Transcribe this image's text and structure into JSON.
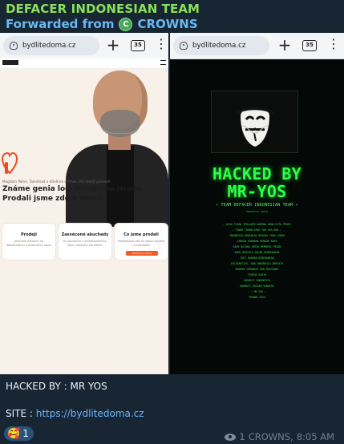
{
  "message": {
    "sender": "DEFACER INDONESIAN TEAM",
    "forwarded_label": "Forwarded from",
    "forward_source": "CROWNS",
    "forward_avatar": "C",
    "caption_line_1": "HACKED BY : MR YOS",
    "site_label": "SITE : ",
    "site_url": "https://bydlitedoma.cz",
    "reaction_icon": "🥰",
    "reaction_count": "1",
    "views": "1",
    "author": "CROWNS,",
    "time": "8:05 AM"
  },
  "left_screenshot": {
    "url": "bydlitedoma.cz",
    "tabs_count": "35",
    "small_text": "Magdam Pálne, Talentová a důvěrná v Praze. Pro menší ponorné",
    "title_line_1": "Známe genia loci Středního Hradu",
    "title_line_2": "Prodali jsme zde 9 domů",
    "cards": [
      {
        "title": "Prodeji",
        "text": "přesnělá úsilovné na dobastrákem a posledních konsi"
      },
      {
        "title": "Zasvěcené akuchady",
        "text": "na posudcích a profesionálního, jako i zpráva k ponatelní"
      },
      {
        "title": "Co jsme prodali",
        "text": "Podrobnosti zde se nalezi najdete i s marketem",
        "button": "Reference domy"
      }
    ]
  },
  "right_screenshot": {
    "url": "bydlitedoma.cz",
    "tabs_count": "35",
    "title_line_1": "HACKED BY",
    "title_line_2": "MR-YOS",
    "team": "⚡ TEAM DEFACER INDONESIAN TEAM ⚡",
    "team_sub": "INDONESIA UNIAN",
    "lines": [
      "⚡ AYAH TIDAK TERLAHIR KARENA AKAN KITA PEDIH",
      "— TANPA TUHAN KAMI TAK APA-APA —",
      "INDONESIA BUKANLAH NEGARA YANG LEMAH",
      "JANGAN PANDANG RENDAH KAMI",
      "KAMI DATANG UNTUK MEMBERI PESAN",
      "KAMI BERSATU DALAM KEBERANIAN",
      "TAPI DENGAN KEBERANIAN",
      "SOLIDARITAS. DAN INDONESIA BERSATU",
      "DENGAN SEMANGAT DAN BERJUANG",
      "TERIMA KASIH",
      "HORMATI INDONESIA",
      "HORMATI SUSIAN SENDIRI",
      "⚡ ⚡ MR-YOS ⚡",
      "CROWNS 2024"
    ]
  }
}
